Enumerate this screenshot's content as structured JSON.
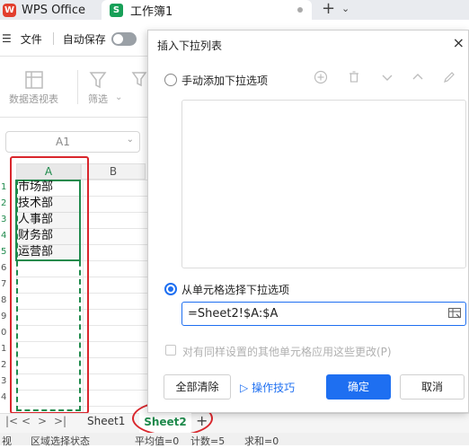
{
  "titlebar": {
    "app_logo_text": "W",
    "app_title": "WPS Office",
    "doc_icon_text": "S",
    "doc_title": "工作簿1",
    "new_tab": "+",
    "caret": "⌄"
  },
  "menubar": {
    "menu_icon": "☰",
    "file": "文件",
    "autosave": "自动保存"
  },
  "toolbar": {
    "pivot_label": "数据透视表",
    "filter_label": "筛选",
    "filter_caret": "⌄"
  },
  "namebox": {
    "value": "A1"
  },
  "grid": {
    "columns": [
      "A",
      "B"
    ],
    "rows": [
      "1",
      "2",
      "3",
      "4",
      "5",
      "6",
      "7",
      "8",
      "9",
      "0",
      "1",
      "2",
      "3",
      "4"
    ],
    "cells": [
      "市场部",
      "技术部",
      "人事部",
      "财务部",
      "运营部"
    ]
  },
  "sheets": {
    "nav": [
      "|<",
      "<",
      ">",
      ">|"
    ],
    "tabs": [
      "Sheet1",
      "Sheet2"
    ],
    "active": "Sheet2",
    "add": "+"
  },
  "statusbar": {
    "left": "视",
    "mode": "区域选择状态",
    "average": "平均值=0",
    "count": "计数=5",
    "sum": "求和=0"
  },
  "dialog": {
    "title": "插入下拉列表",
    "close": "×",
    "option_manual": "手动添加下拉选项",
    "option_cells": "从单元格选择下拉选项",
    "source_value": "=Sheet2!$A:$A",
    "apply_same": "对有同样设置的其他单元格应用这些更改(P)",
    "clear_all": "全部清除",
    "tips": "操作技巧",
    "ok": "确定",
    "cancel": "取消",
    "accent": "#1e6ff1"
  }
}
